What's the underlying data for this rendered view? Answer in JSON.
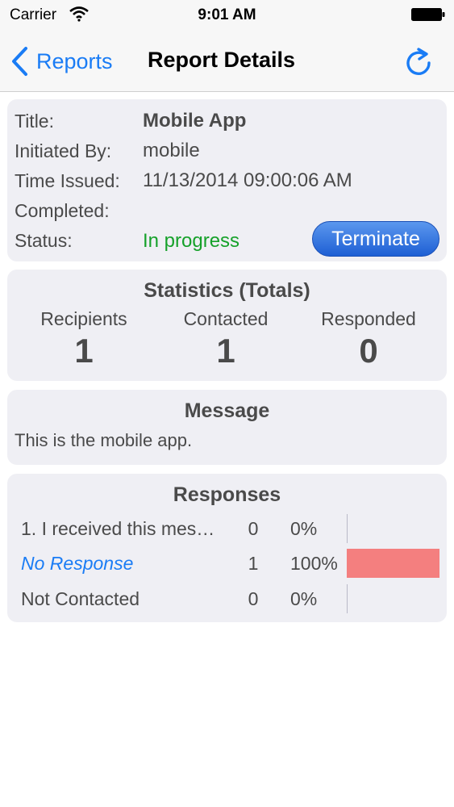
{
  "status_bar": {
    "carrier": "Carrier",
    "time": "9:01 AM"
  },
  "nav": {
    "back_label": "Reports",
    "title": "Report Details"
  },
  "details": {
    "title_label": "Title:",
    "title_value": "Mobile App",
    "initiated_label": "Initiated By:",
    "initiated_value": "mobile",
    "issued_label": "Time Issued:",
    "issued_value": "11/13/2014 09:00:06 AM",
    "completed_label": "Completed:",
    "completed_value": "",
    "status_label": "Status:",
    "status_value": "In progress",
    "terminate_label": "Terminate",
    "status_color": "#16a12a"
  },
  "statistics": {
    "heading": "Statistics (Totals)",
    "items": [
      {
        "label": "Recipients",
        "value": "1"
      },
      {
        "label": "Contacted",
        "value": "1"
      },
      {
        "label": "Responded",
        "value": "0"
      }
    ]
  },
  "message": {
    "heading": "Message",
    "text": "This is the mobile app."
  },
  "responses": {
    "heading": "Responses",
    "rows": [
      {
        "label": "1. I received this mes…",
        "count": "0",
        "percent": "0%",
        "fraction": 0
      },
      {
        "label": "No Response",
        "count": "1",
        "percent": "100%",
        "fraction": 1
      },
      {
        "label": "Not Contacted",
        "count": "0",
        "percent": "0%",
        "fraction": 0
      }
    ],
    "bar_color": "#f47f7f"
  },
  "colors": {
    "accent": "#1a7cf5",
    "card_background": "#efeff4"
  }
}
